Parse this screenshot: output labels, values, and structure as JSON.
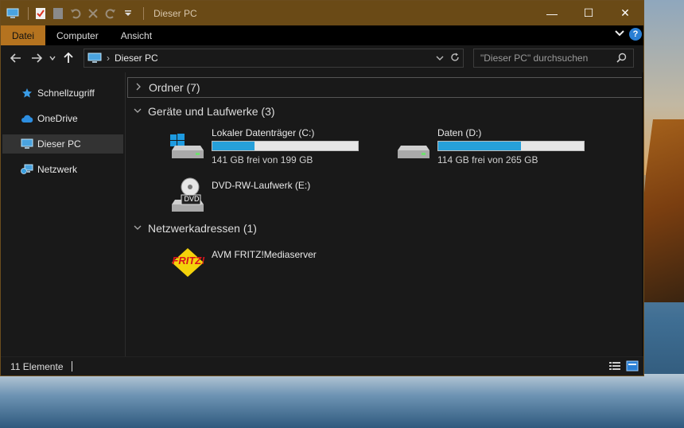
{
  "window": {
    "title": "Dieser PC"
  },
  "window_controls": {
    "minimize": "—",
    "maximize": "☐",
    "close": "✕"
  },
  "ribbon": {
    "tabs": [
      {
        "label": "Datei",
        "active": true
      },
      {
        "label": "Computer",
        "active": false
      },
      {
        "label": "Ansicht",
        "active": false
      }
    ],
    "help": "?"
  },
  "address": {
    "separator": "›",
    "path": "Dieser PC",
    "search_placeholder": "\"Dieser PC\" durchsuchen"
  },
  "sidebar": {
    "items": [
      {
        "label": "Schnellzugriff",
        "icon": "star-icon"
      },
      {
        "label": "OneDrive",
        "icon": "cloud-icon"
      },
      {
        "label": "Dieser PC",
        "icon": "computer-icon",
        "selected": true
      },
      {
        "label": "Netzwerk",
        "icon": "network-icon"
      }
    ]
  },
  "groups": {
    "folders": {
      "label": "Ordner (7)",
      "collapsed": true
    },
    "drives": {
      "label": "Geräte und Laufwerke (3)"
    },
    "network": {
      "label": "Netzwerkadressen (1)"
    }
  },
  "drives": [
    {
      "name": "Lokaler Datenträger (C:)",
      "free": "141 GB frei von 199 GB",
      "used_fraction": 0.29,
      "icon": "windows-drive-icon"
    },
    {
      "name": "Daten (D:)",
      "free": "114 GB frei von 265 GB",
      "used_fraction": 0.57,
      "icon": "drive-icon"
    },
    {
      "name": "DVD-RW-Laufwerk (E:)",
      "icon": "dvd-drive-icon",
      "badge": "DVD"
    }
  ],
  "network_locations": [
    {
      "name": "AVM FRITZ!Mediaserver",
      "icon": "fritz-icon",
      "logo_text": "FRITZ!"
    }
  ],
  "status": {
    "count": "11 Elemente"
  },
  "colors": {
    "accent": "#b5731f",
    "titlebar": "#6a4a16",
    "progress": "#26a0da",
    "background": "#191919"
  }
}
